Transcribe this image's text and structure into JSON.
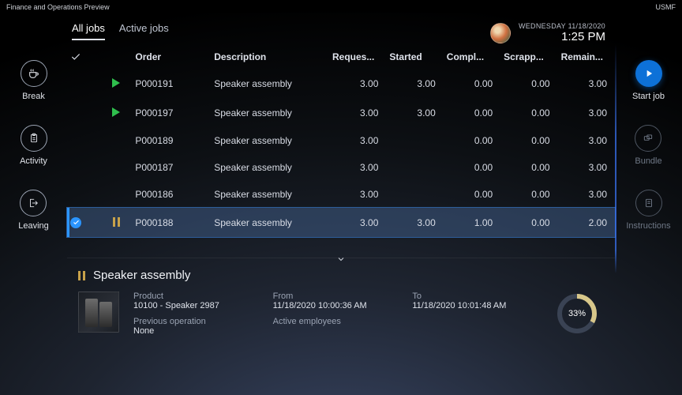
{
  "title_bar": {
    "app_name": "Finance and Operations Preview",
    "company": "USMF"
  },
  "header": {
    "tabs": [
      {
        "id": "all",
        "label": "All jobs",
        "active": true
      },
      {
        "id": "active",
        "label": "Active jobs",
        "active": false
      }
    ],
    "date": "WEDNESDAY 11/18/2020",
    "time": "1:25 PM"
  },
  "left_rail": {
    "break": {
      "label": "Break",
      "icon": "coffee-icon"
    },
    "activity": {
      "label": "Activity",
      "icon": "clipboard-icon"
    },
    "leaving": {
      "label": "Leaving",
      "icon": "leave-icon"
    }
  },
  "right_rail": {
    "start": {
      "label": "Start job",
      "icon": "play-icon",
      "enabled": true
    },
    "bundle": {
      "label": "Bundle",
      "icon": "bundle-icon",
      "enabled": false
    },
    "instructions": {
      "label": "Instructions",
      "icon": "instructions-icon",
      "enabled": false
    }
  },
  "columns": {
    "order": "Order",
    "description": "Description",
    "requested": "Reques...",
    "started": "Started",
    "completed": "Compl...",
    "scrapped": "Scrapp...",
    "remaining": "Remain..."
  },
  "jobs": [
    {
      "status": "running",
      "order": "P000191",
      "description": "Speaker assembly",
      "requested": "3.00",
      "started": "3.00",
      "completed": "0.00",
      "scrapped": "0.00",
      "remaining": "3.00",
      "selected": false
    },
    {
      "status": "running",
      "order": "P000197",
      "description": "Speaker assembly",
      "requested": "3.00",
      "started": "3.00",
      "completed": "0.00",
      "scrapped": "0.00",
      "remaining": "3.00",
      "selected": false
    },
    {
      "status": "none",
      "order": "P000189",
      "description": "Speaker assembly",
      "requested": "3.00",
      "started": "",
      "completed": "0.00",
      "scrapped": "0.00",
      "remaining": "3.00",
      "selected": false
    },
    {
      "status": "none",
      "order": "P000187",
      "description": "Speaker assembly",
      "requested": "3.00",
      "started": "",
      "completed": "0.00",
      "scrapped": "0.00",
      "remaining": "3.00",
      "selected": false
    },
    {
      "status": "none",
      "order": "P000186",
      "description": "Speaker assembly",
      "requested": "3.00",
      "started": "",
      "completed": "0.00",
      "scrapped": "0.00",
      "remaining": "3.00",
      "selected": false
    },
    {
      "status": "paused",
      "order": "P000188",
      "description": "Speaker assembly",
      "requested": "3.00",
      "started": "3.00",
      "completed": "1.00",
      "scrapped": "0.00",
      "remaining": "2.00",
      "selected": true
    }
  ],
  "detail": {
    "title": "Speaker assembly",
    "product_label": "Product",
    "product_value": "10100 - Speaker 2987",
    "prev_op_label": "Previous operation",
    "prev_op_value": "None",
    "from_label": "From",
    "from_value": "11/18/2020 10:00:36 AM",
    "to_label": "To",
    "to_value": "11/18/2020 10:01:48 AM",
    "active_emp_label": "Active employees",
    "active_emp_value": "",
    "progress_pct": 33,
    "progress_label": "33%"
  }
}
